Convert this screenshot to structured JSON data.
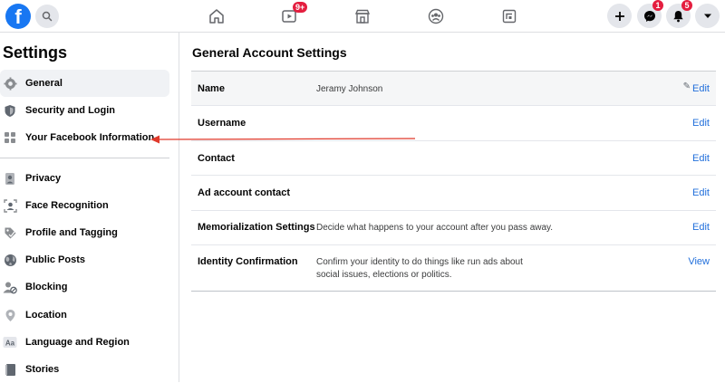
{
  "topbar": {
    "logo_letter": "f",
    "video_badge": "9+",
    "messenger_badge": "1",
    "notifications_badge": "5"
  },
  "sidebar": {
    "title": "Settings",
    "items": [
      {
        "label": "General",
        "icon": "gear-icon",
        "active": true
      },
      {
        "label": "Security and Login",
        "icon": "shield-icon"
      },
      {
        "label": "Your Facebook Information",
        "icon": "grid-icon"
      },
      {
        "label": "Privacy",
        "icon": "lock-person-icon"
      },
      {
        "label": "Face Recognition",
        "icon": "face-scan-icon"
      },
      {
        "label": "Profile and Tagging",
        "icon": "tag-icon"
      },
      {
        "label": "Public Posts",
        "icon": "globe-icon"
      },
      {
        "label": "Blocking",
        "icon": "block-user-icon"
      },
      {
        "label": "Location",
        "icon": "location-pin-icon"
      },
      {
        "label": "Language and Region",
        "icon": "language-icon"
      },
      {
        "label": "Stories",
        "icon": "book-icon"
      }
    ]
  },
  "main": {
    "title": "General Account Settings",
    "rows": [
      {
        "label": "Name",
        "value": "Jeramy Johnson",
        "action": "Edit"
      },
      {
        "label": "Username",
        "value": "",
        "action": "Edit"
      },
      {
        "label": "Contact",
        "value": "",
        "action": "Edit"
      },
      {
        "label": "Ad account contact",
        "value": "",
        "action": "Edit"
      },
      {
        "label": "Memorialization Settings",
        "value": "Decide what happens to your account after you pass away.",
        "action": "Edit"
      },
      {
        "label": "Identity Confirmation",
        "value_line1": "Confirm your identity to do things like run ads about",
        "value_line2": "social issues, elections or politics.",
        "action": "View"
      }
    ]
  },
  "colors": {
    "brand": "#1877f2",
    "link": "#216fdb",
    "badge": "#e41e3f",
    "annotation_arrow": "#e0392b"
  }
}
